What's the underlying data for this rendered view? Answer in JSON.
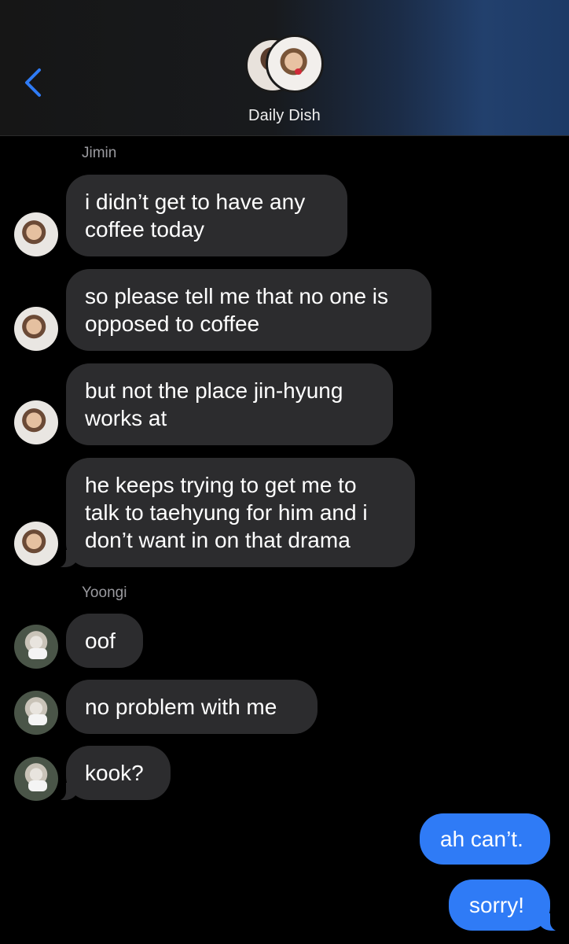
{
  "header": {
    "title": "Daily Dish",
    "back_icon": "chevron-left-icon",
    "accent_color": "#2f7bf6"
  },
  "senders": {
    "jimin": "Jimin",
    "yoongi": "Yoongi"
  },
  "messages": [
    {
      "from": "Jimin",
      "text": "i didn’t get to have any\ncoffee today"
    },
    {
      "from": "Jimin",
      "text": "so please tell me that no one is\nopposed to coffee"
    },
    {
      "from": "Jimin",
      "text": "but not the place jin-hyung\nworks at"
    },
    {
      "from": "Jimin",
      "text": "he keeps trying to get me to\ntalk to taehyung for him and i\ndon’t want in on that drama"
    },
    {
      "from": "Yoongi",
      "text": "oof"
    },
    {
      "from": "Yoongi",
      "text": "no problem with me"
    },
    {
      "from": "Yoongi",
      "text": "kook?"
    },
    {
      "from": "me",
      "text": "ah can’t."
    },
    {
      "from": "me",
      "text": "sorry!"
    }
  ],
  "colors": {
    "received_bubble": "#2c2c2e",
    "sent_bubble": "#2f7bf6",
    "background": "#000000"
  }
}
